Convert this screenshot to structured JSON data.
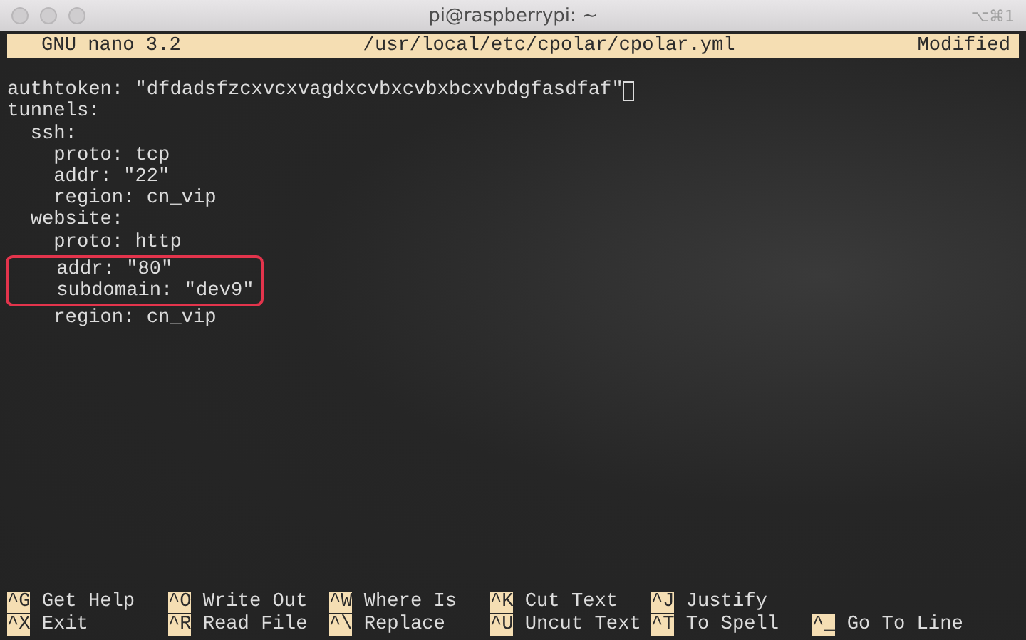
{
  "window": {
    "title": "pi@raspberrypi: ~",
    "shortcut": "⌥⌘1"
  },
  "nano_bar": {
    "version": "GNU nano 3.2",
    "file": "/usr/local/etc/cpolar/cpolar.yml",
    "status": "Modified"
  },
  "editor": {
    "blocks": [
      {
        "kind": "plain",
        "lines": [
          {
            "text": "authtoken: \"dfdadsfzcxvcxvagdxcvbxcvbxbcxvbdgfasdfaf\"",
            "cursor": true
          },
          {
            "text": "tunnels:",
            "cursor": false
          },
          {
            "text": "  ssh:",
            "cursor": false
          },
          {
            "text": "    proto: tcp",
            "cursor": false
          },
          {
            "text": "    addr: \"22\"",
            "cursor": false
          },
          {
            "text": "    region: cn_vip",
            "cursor": false
          },
          {
            "text": "  website:",
            "cursor": false
          },
          {
            "text": "    proto: http",
            "cursor": false
          }
        ]
      },
      {
        "kind": "highlight",
        "lines": [
          {
            "text": "    addr: \"80\"",
            "cursor": false
          },
          {
            "text": "    subdomain: \"dev9\"",
            "cursor": false
          }
        ]
      },
      {
        "kind": "plain",
        "lines": [
          {
            "text": "    region: cn_vip",
            "cursor": false
          }
        ]
      }
    ]
  },
  "shortcuts": [
    [
      {
        "key": "^G",
        "label": "Get Help"
      },
      {
        "key": "^O",
        "label": "Write Out"
      },
      {
        "key": "^W",
        "label": "Where Is"
      },
      {
        "key": "^K",
        "label": "Cut Text"
      },
      {
        "key": "^J",
        "label": "Justify"
      }
    ],
    [
      {
        "key": "^X",
        "label": "Exit"
      },
      {
        "key": "^R",
        "label": "Read File"
      },
      {
        "key": "^\\",
        "label": "Replace"
      },
      {
        "key": "^U",
        "label": "Uncut Text"
      },
      {
        "key": "^T",
        "label": "To Spell"
      },
      {
        "key": "^_",
        "label": "Go To Line"
      }
    ]
  ]
}
